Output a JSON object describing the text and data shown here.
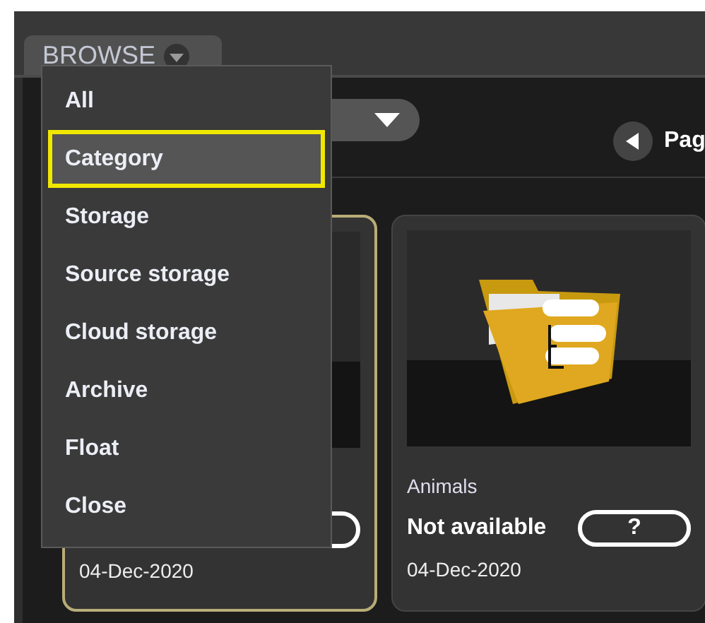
{
  "tab": {
    "label": "BROWSE"
  },
  "menu": {
    "items": [
      {
        "label": "All",
        "selected": false
      },
      {
        "label": "Category",
        "selected": true
      },
      {
        "label": "Storage",
        "selected": false
      },
      {
        "label": "Source storage",
        "selected": false
      },
      {
        "label": "Cloud storage",
        "selected": false
      },
      {
        "label": "Archive",
        "selected": false
      },
      {
        "label": "Float",
        "selected": false
      },
      {
        "label": "Close",
        "selected": false
      }
    ]
  },
  "pager": {
    "label": "Pag"
  },
  "cards": [
    {
      "kind": "plain",
      "selected": true,
      "date": "04-Dec-2020"
    },
    {
      "kind": "folder",
      "selected": false,
      "title": "Animals",
      "status": "Not available",
      "button": "?",
      "date": "04-Dec-2020"
    }
  ]
}
